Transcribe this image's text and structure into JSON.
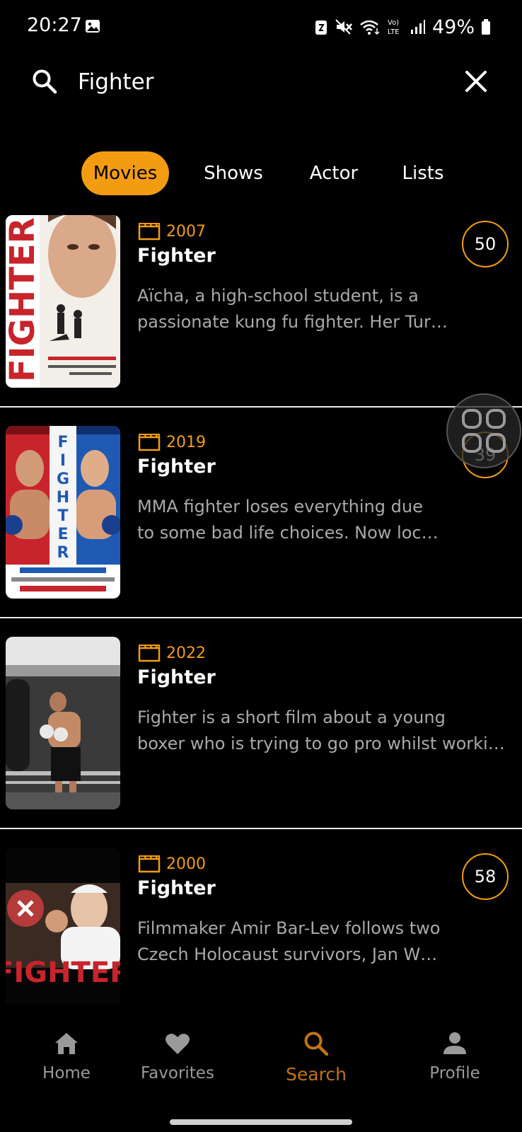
{
  "status_bar": {
    "time": "20:27",
    "battery_percent": "49%",
    "icons": [
      "gallery-notification-icon",
      "data-saver-icon",
      "mute-icon",
      "wifi-icon",
      "volte-icon",
      "signal-icon",
      "battery-icon"
    ]
  },
  "search": {
    "query": "Fighter",
    "icons": [
      "search-icon",
      "close-icon"
    ]
  },
  "tabs": [
    {
      "label": "Movies",
      "active": true
    },
    {
      "label": "Shows",
      "active": false
    },
    {
      "label": "Actor",
      "active": false
    },
    {
      "label": "Lists",
      "active": false
    }
  ],
  "results": [
    {
      "year": "2007",
      "title": "Fighter",
      "desc_line1": "Aïcha, a high-school student, is a",
      "desc_line2": "passionate kung fu fighter. Her Tur…",
      "score": "50",
      "poster_text": "FIGHTER"
    },
    {
      "year": "2019",
      "title": "Fighter",
      "desc_line1": "MMA fighter loses everything due",
      "desc_line2": "to some bad life choices. Now loc…",
      "score": "39",
      "poster_text": "FIGHTER"
    },
    {
      "year": "2022",
      "title": "Fighter",
      "desc_line1": "Fighter is a short film about a young",
      "desc_line2": "boxer who is trying to go pro whilst worki…",
      "score": "",
      "poster_text": ""
    },
    {
      "year": "2000",
      "title": "Fighter",
      "desc_line1": "Filmmaker Amir Bar-Lev follows two",
      "desc_line2": "Czech Holocaust survivors, Jan W…",
      "score": "58",
      "poster_text": "FIGHTER"
    }
  ],
  "bottom_nav": [
    {
      "label": "Home",
      "icon": "home-icon",
      "active": false
    },
    {
      "label": "Favorites",
      "icon": "heart-icon",
      "active": false
    },
    {
      "label": "Search",
      "icon": "search-icon",
      "active": true
    },
    {
      "label": "Profile",
      "icon": "person-icon",
      "active": false
    }
  ],
  "colors": {
    "accent": "#f39c12",
    "background": "#000000",
    "muted_text": "#a9a9a9"
  }
}
